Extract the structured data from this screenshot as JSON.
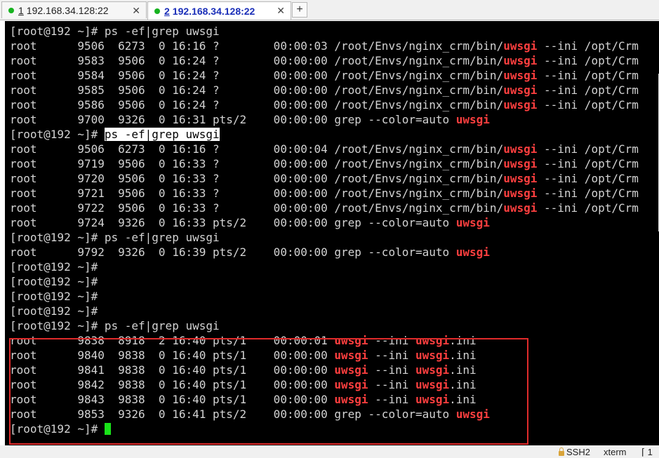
{
  "tabs": [
    {
      "num": "1",
      "title": "192.168.34.128:22",
      "close": "✕"
    },
    {
      "num": "2",
      "title": "192.168.34.128:22",
      "close": "✕"
    }
  ],
  "tab_add_label": "+",
  "terminal": {
    "lines": [
      [
        {
          "t": "[root@192 ~]# ps -ef|grep uwsgi"
        }
      ],
      [
        {
          "t": "root      9506  6273  0 16:16 ?        00:00:03 /root/Envs/nginx_crm/bin/"
        },
        {
          "t": "uwsgi",
          "c": "red"
        },
        {
          "t": " --ini /opt/Crm"
        }
      ],
      [
        {
          "t": "root      9583  9506  0 16:24 ?        00:00:00 /root/Envs/nginx_crm/bin/"
        },
        {
          "t": "uwsgi",
          "c": "red"
        },
        {
          "t": " --ini /opt/Crm"
        }
      ],
      [
        {
          "t": "root      9584  9506  0 16:24 ?        00:00:00 /root/Envs/nginx_crm/bin/"
        },
        {
          "t": "uwsgi",
          "c": "red"
        },
        {
          "t": " --ini /opt/Crm"
        }
      ],
      [
        {
          "t": "root      9585  9506  0 16:24 ?        00:00:00 /root/Envs/nginx_crm/bin/"
        },
        {
          "t": "uwsgi",
          "c": "red"
        },
        {
          "t": " --ini /opt/Crm"
        }
      ],
      [
        {
          "t": "root      9586  9506  0 16:24 ?        00:00:00 /root/Envs/nginx_crm/bin/"
        },
        {
          "t": "uwsgi",
          "c": "red"
        },
        {
          "t": " --ini /opt/Crm"
        }
      ],
      [
        {
          "t": "root      9700  9326  0 16:31 pts/2    00:00:00 grep --color=auto "
        },
        {
          "t": "uwsgi",
          "c": "red"
        }
      ],
      [
        {
          "t": "[root@192 ~]# "
        },
        {
          "t": "ps -ef|grep uwsgi",
          "c": "cmd-hl"
        }
      ],
      [
        {
          "t": "root      9506  6273  0 16:16 ?        00:00:04 /root/Envs/nginx_crm/bin/"
        },
        {
          "t": "uwsgi",
          "c": "red"
        },
        {
          "t": " --ini /opt/Crm"
        }
      ],
      [
        {
          "t": "root      9719  9506  0 16:33 ?        00:00:00 /root/Envs/nginx_crm/bin/"
        },
        {
          "t": "uwsgi",
          "c": "red"
        },
        {
          "t": " --ini /opt/Crm"
        }
      ],
      [
        {
          "t": "root      9720  9506  0 16:33 ?        00:00:00 /root/Envs/nginx_crm/bin/"
        },
        {
          "t": "uwsgi",
          "c": "red"
        },
        {
          "t": " --ini /opt/Crm"
        }
      ],
      [
        {
          "t": "root      9721  9506  0 16:33 ?        00:00:00 /root/Envs/nginx_crm/bin/"
        },
        {
          "t": "uwsgi",
          "c": "red"
        },
        {
          "t": " --ini /opt/Crm"
        }
      ],
      [
        {
          "t": "root      9722  9506  0 16:33 ?        00:00:00 /root/Envs/nginx_crm/bin/"
        },
        {
          "t": "uwsgi",
          "c": "red"
        },
        {
          "t": " --ini /opt/Crm"
        }
      ],
      [
        {
          "t": "root      9724  9326  0 16:33 pts/2    00:00:00 grep --color=auto "
        },
        {
          "t": "uwsgi",
          "c": "red"
        }
      ],
      [
        {
          "t": "[root@192 ~]# ps -ef|grep uwsgi"
        }
      ],
      [
        {
          "t": "root      9792  9326  0 16:39 pts/2    00:00:00 grep --color=auto "
        },
        {
          "t": "uwsgi",
          "c": "red"
        }
      ],
      [
        {
          "t": "[root@192 ~]#"
        }
      ],
      [
        {
          "t": "[root@192 ~]#"
        }
      ],
      [
        {
          "t": "[root@192 ~]#"
        }
      ],
      [
        {
          "t": "[root@192 ~]#"
        }
      ],
      [
        {
          "t": "[root@192 ~]# ps -ef|grep uwsgi"
        }
      ],
      [
        {
          "t": "root      9838  8918  2 16:40 pts/1    00:00:01 "
        },
        {
          "t": "uwsgi",
          "c": "red"
        },
        {
          "t": " --ini "
        },
        {
          "t": "uwsgi",
          "c": "red"
        },
        {
          "t": ".ini"
        }
      ],
      [
        {
          "t": "root      9840  9838  0 16:40 pts/1    00:00:00 "
        },
        {
          "t": "uwsgi",
          "c": "red"
        },
        {
          "t": " --ini "
        },
        {
          "t": "uwsgi",
          "c": "red"
        },
        {
          "t": ".ini"
        }
      ],
      [
        {
          "t": "root      9841  9838  0 16:40 pts/1    00:00:00 "
        },
        {
          "t": "uwsgi",
          "c": "red"
        },
        {
          "t": " --ini "
        },
        {
          "t": "uwsgi",
          "c": "red"
        },
        {
          "t": ".ini"
        }
      ],
      [
        {
          "t": "root      9842  9838  0 16:40 pts/1    00:00:00 "
        },
        {
          "t": "uwsgi",
          "c": "red"
        },
        {
          "t": " --ini "
        },
        {
          "t": "uwsgi",
          "c": "red"
        },
        {
          "t": ".ini"
        }
      ],
      [
        {
          "t": "root      9843  9838  0 16:40 pts/1    00:00:00 "
        },
        {
          "t": "uwsgi",
          "c": "red"
        },
        {
          "t": " --ini "
        },
        {
          "t": "uwsgi",
          "c": "red"
        },
        {
          "t": ".ini"
        }
      ],
      [
        {
          "t": "root      9853  9326  0 16:41 pts/2    00:00:00 grep --color=auto "
        },
        {
          "t": "uwsgi",
          "c": "red"
        }
      ],
      [
        {
          "t": "[root@192 ~]# "
        },
        {
          "t": "",
          "c": "cursor"
        }
      ]
    ]
  },
  "status": {
    "protocol": "SSH2",
    "term": "xterm",
    "misc": "⌈ 1"
  },
  "colors": {
    "terminal_bg": "#000000",
    "text": "#d3d3d3",
    "match": "#ff3f3f",
    "cursor": "#19e219",
    "highlight_box": "#e02b2b",
    "tab_dot": "#17b320"
  }
}
